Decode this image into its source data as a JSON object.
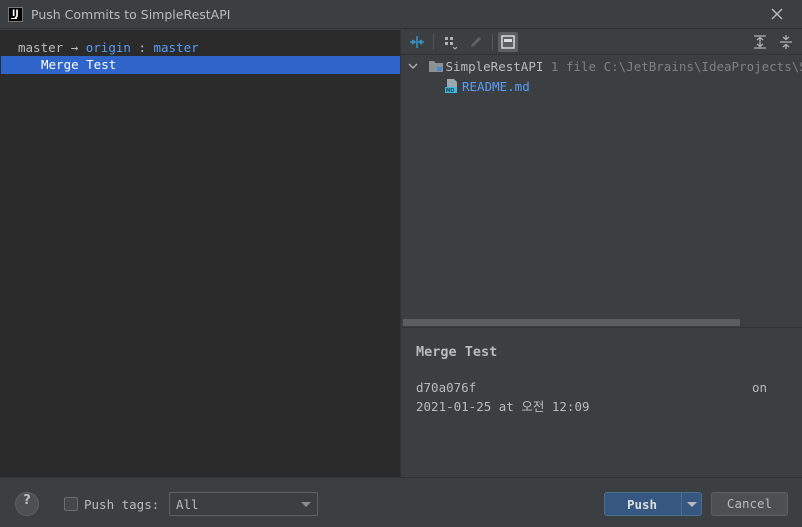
{
  "window": {
    "title": "Push Commits to SimpleRestAPI",
    "app_icon_glyph": "IJ",
    "close_icon": "close-icon"
  },
  "left": {
    "branch": {
      "local": "master",
      "arrow": "→",
      "remote": "origin",
      "colon": ":",
      "remote_branch": "master"
    },
    "commits": [
      {
        "subject": "Merge Test",
        "selected": true
      }
    ]
  },
  "toolbar": {
    "icons": [
      "compare-arrows-icon",
      "group-by-icon",
      "edit-icon",
      "preview-panel-icon",
      "expand-all-icon",
      "collapse-all-icon"
    ]
  },
  "tree": {
    "root": {
      "name": "SimpleRestAPI",
      "count": "1 file",
      "path": "C:\\JetBrains\\IdeaProjects\\Simp"
    },
    "files": [
      {
        "name": "README.md",
        "icon": "markdown-file-icon"
      }
    ]
  },
  "details": {
    "subject": "Merge Test",
    "hash": "d70a076f",
    "on_label": "on",
    "date": "2021-01-25 at 오전 12:09"
  },
  "footer": {
    "help_label": "?",
    "push_tags_label": "Push tags:",
    "push_tags_checked": false,
    "tags_select_value": "All",
    "push_label": "Push",
    "cancel_label": "Cancel"
  },
  "colors": {
    "background": "#3c3f41",
    "panel_dark": "#2b2b2b",
    "selection": "#2f65ca",
    "link": "#589df6",
    "primary_button": "#365880"
  }
}
